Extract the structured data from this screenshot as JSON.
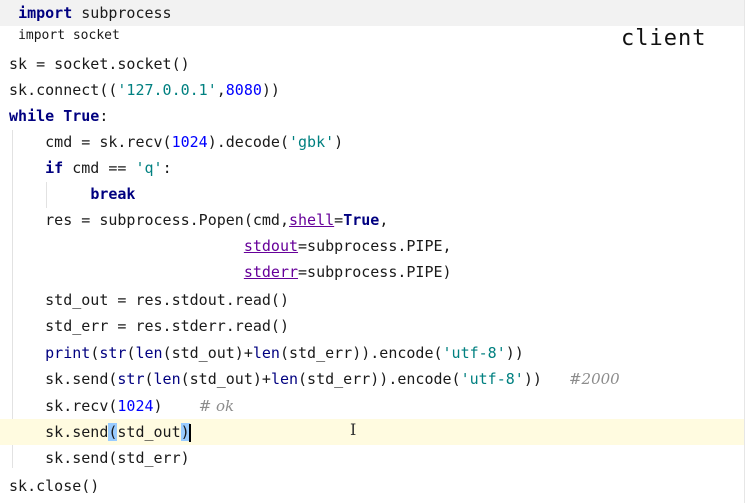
{
  "code": {
    "line1": [
      "import",
      " subprocess"
    ],
    "line2": "import socket",
    "line3": "sk = socket.socket()",
    "line4": [
      "sk.connect((",
      "'127.0.0.1'",
      ",",
      "8080",
      "))"
    ],
    "line5": [
      "while",
      " ",
      "True",
      ":"
    ],
    "line6": [
      "cmd = sk.recv(",
      "1024",
      ").decode(",
      "'gbk'",
      ")"
    ],
    "line7": [
      "if",
      " cmd == ",
      "'q'",
      ":"
    ],
    "line8": "break",
    "line9": [
      "res = subprocess.Popen(cmd,",
      "shell",
      "=",
      "True",
      ","
    ],
    "line10": [
      "stdout",
      "=subprocess.PIPE,"
    ],
    "line11": [
      "stderr",
      "=subprocess.PIPE)"
    ],
    "line12": "std_out = res.stdout.read()",
    "line13": "std_err = res.stderr.read()",
    "line14": [
      "print",
      "(",
      "str",
      "(",
      "len",
      "(std_out)+",
      "len",
      "(std_err)).encode(",
      "'utf-8'",
      "))"
    ],
    "line15": [
      "sk.send(",
      "str",
      "(",
      "len",
      "(std_out)+",
      "len",
      "(std_err)).encode(",
      "'utf-8'",
      "))",
      "#2000"
    ],
    "line16": [
      "sk.recv(",
      "1024",
      ")",
      "# ok"
    ],
    "line17": [
      "sk.send",
      "(",
      "std_out",
      ")"
    ],
    "line18": "sk.send(std_err)",
    "line19": "sk.close()"
  },
  "annotation": {
    "client_label": "client",
    "cursor_glyph": "I"
  },
  "colors": {
    "keyword": "#000080",
    "string": "#008080",
    "number": "#0000ff",
    "comment": "#8c8c8c",
    "current_line": "#fffbe0",
    "brace_match": "#99ccff"
  }
}
